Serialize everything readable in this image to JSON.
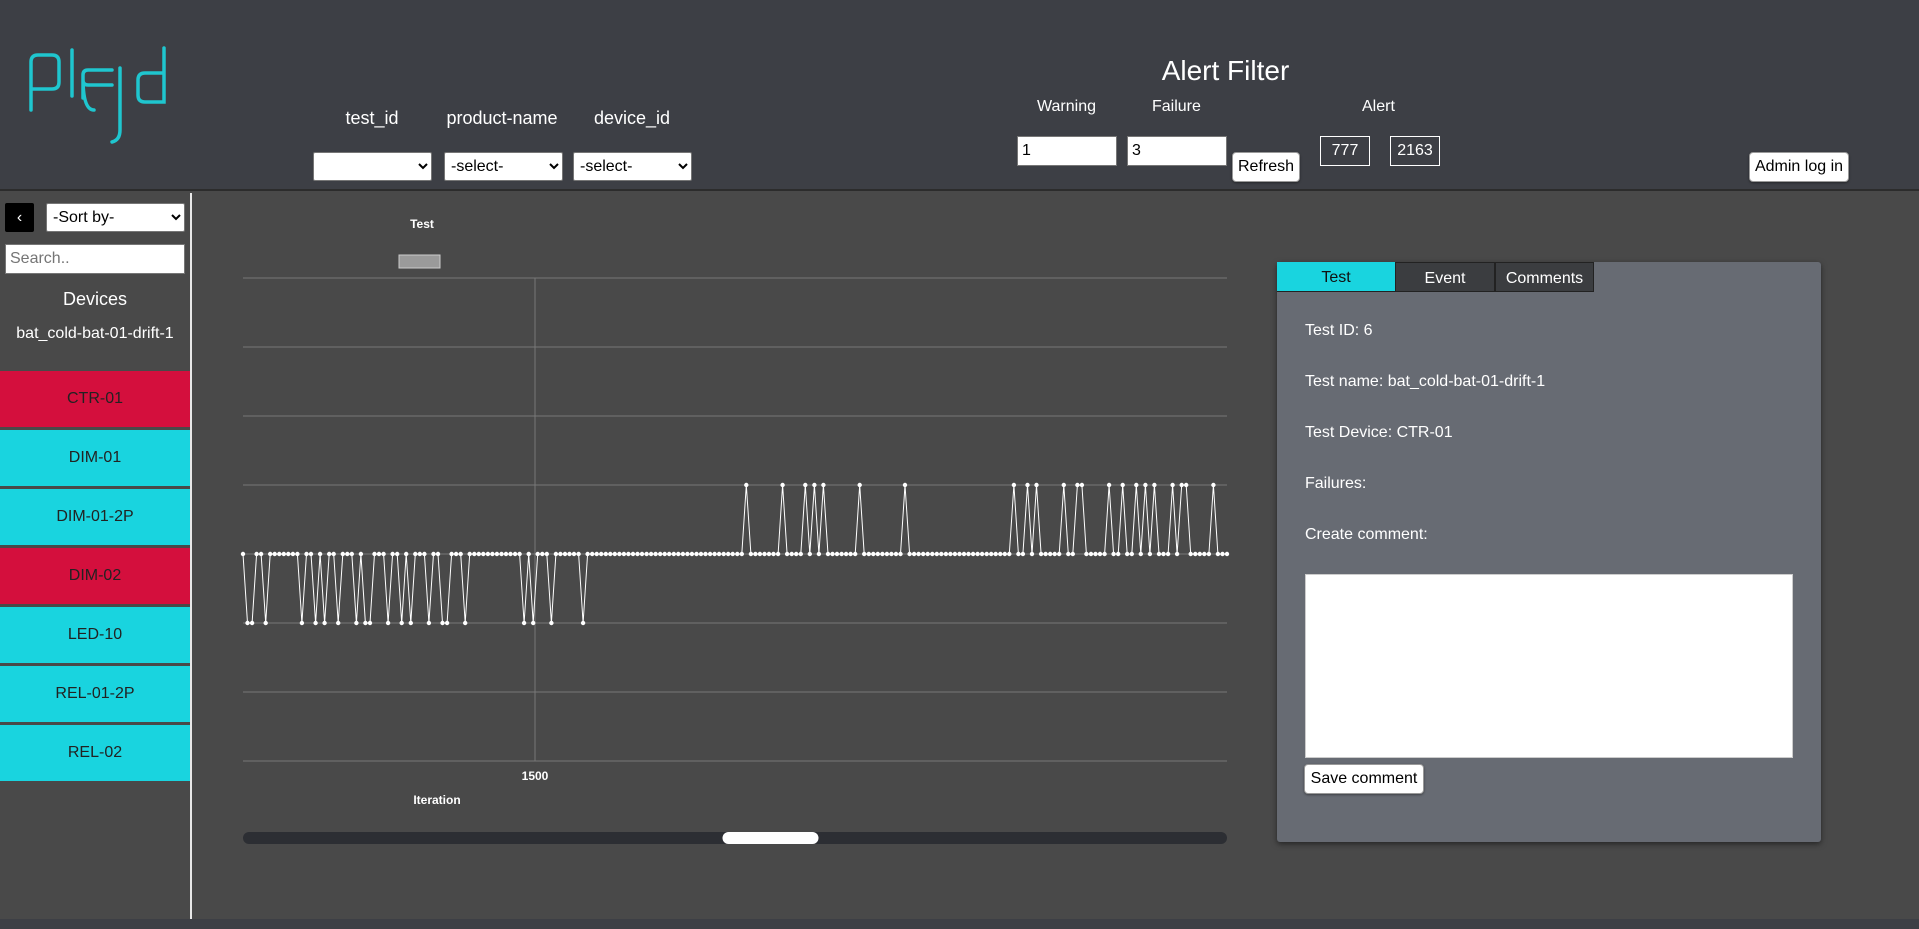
{
  "header": {
    "filters": [
      {
        "label": "test_id",
        "value": ""
      },
      {
        "label": "product-name",
        "value": "-select-"
      },
      {
        "label": "device_id",
        "value": "-select-"
      }
    ],
    "alert_filter": {
      "title": "Alert Filter",
      "warning_label": "Warning",
      "warning_value": "1",
      "failure_label": "Failure",
      "failure_value": "3",
      "refresh_label": "Refresh",
      "alert_label": "Alert",
      "alert_count_1": "777",
      "alert_count_2": "2163"
    },
    "admin_login_label": "Admin log in"
  },
  "sidebar": {
    "back_label": "‹",
    "sort_value": "-Sort by-",
    "search_placeholder": "Search..",
    "devices_title": "Devices",
    "test_name": "bat_cold-bat-01-drift-1",
    "devices": [
      {
        "name": "CTR-01",
        "color": "#d40f3d"
      },
      {
        "name": "DIM-01",
        "color": "#19d4df"
      },
      {
        "name": "DIM-01-2P",
        "color": "#19d4df"
      },
      {
        "name": "DIM-02",
        "color": "#d40f3d"
      },
      {
        "name": "LED-10",
        "color": "#19d4df"
      },
      {
        "name": "REL-01-2P",
        "color": "#19d4df"
      },
      {
        "name": "REL-02",
        "color": "#19d4df"
      }
    ]
  },
  "chart_data": {
    "type": "line",
    "legend": "Test",
    "xlabel": "Iteration",
    "x_ticks": [
      "1500"
    ],
    "scrollbar_position": 0.54,
    "levels": 7,
    "baseline_level": 3,
    "pattern": [
      3,
      2,
      2,
      3,
      3,
      2,
      3,
      3,
      3,
      3,
      3,
      3,
      3,
      2,
      3,
      3,
      2,
      3,
      2,
      3,
      3,
      2,
      3,
      3,
      3,
      2,
      3,
      2,
      2,
      3,
      3,
      3,
      2,
      3,
      3,
      2,
      3,
      2,
      3,
      3,
      3,
      2,
      3,
      3,
      2,
      2,
      3,
      3,
      3,
      2,
      3,
      3,
      3,
      3,
      3,
      3,
      3,
      3,
      3,
      3,
      3,
      3,
      2,
      3,
      2,
      3,
      3,
      3,
      2,
      3,
      3,
      3,
      3,
      3,
      3,
      2,
      3,
      3,
      3,
      3,
      3,
      3,
      3,
      3,
      3,
      3,
      3,
      3,
      3,
      3,
      3,
      3,
      3,
      3,
      3,
      3,
      3,
      3,
      3,
      3,
      3,
      3,
      3,
      3,
      3,
      3,
      3,
      3,
      3,
      3,
      3,
      4,
      3,
      3,
      3,
      3,
      3,
      3,
      3,
      4,
      3,
      3,
      3,
      3,
      4,
      3,
      4,
      3,
      4,
      3,
      3,
      3,
      3,
      3,
      3,
      3,
      4,
      3,
      3,
      3,
      3,
      3,
      3,
      3,
      3,
      3,
      4,
      3,
      3,
      3,
      3,
      3,
      3,
      3,
      3,
      3,
      3,
      3,
      3,
      3,
      3,
      3,
      3,
      3,
      3,
      3,
      3,
      3,
      3,
      3,
      4,
      3,
      3,
      4,
      3,
      4,
      3,
      3,
      3,
      3,
      3,
      4,
      3,
      3,
      4,
      4,
      3,
      3,
      3,
      3,
      3,
      4,
      3,
      3,
      4,
      3,
      3,
      4,
      3,
      4,
      3,
      4,
      3,
      3,
      3,
      4,
      3,
      4,
      4,
      3,
      3,
      3,
      3,
      3,
      4,
      3,
      3,
      3
    ]
  },
  "panel": {
    "tabs": [
      {
        "label": "Test"
      },
      {
        "label": "Event"
      },
      {
        "label": "Comments"
      }
    ],
    "test_id": "Test ID: 6",
    "test_name": "Test name: bat_cold-bat-01-drift-1",
    "test_device": "Test Device: CTR-01",
    "failures": "Failures:",
    "create_comment": "Create comment:",
    "save_label": "Save comment"
  }
}
